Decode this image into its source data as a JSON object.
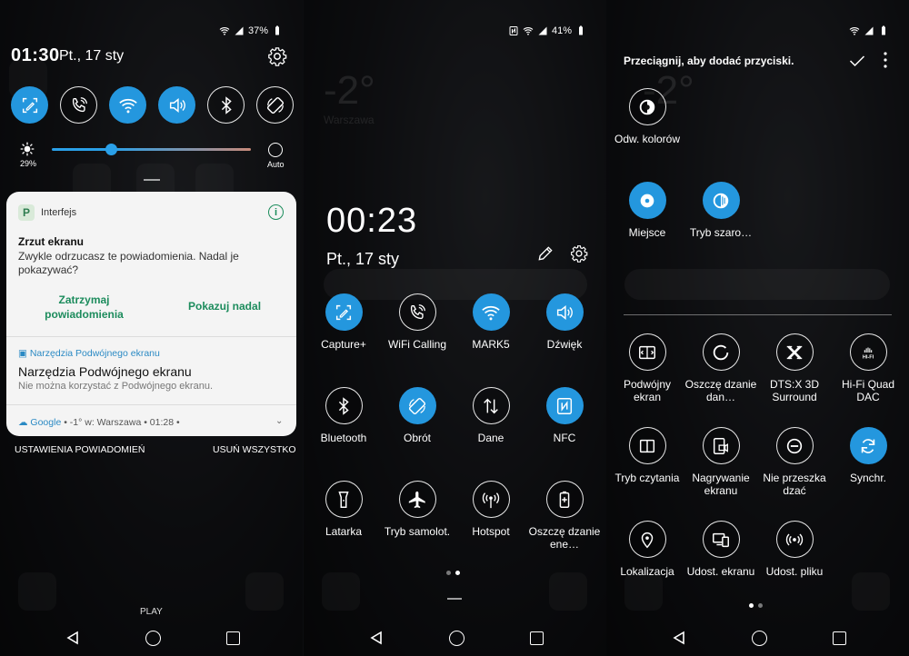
{
  "colors": {
    "accent": "#2497de",
    "notif_action": "#1d8c5d",
    "card_bg": "#f4f4f4"
  },
  "panel1": {
    "status": {
      "battery": "37%"
    },
    "clock": "01:30",
    "date": "Pt., 17 sty",
    "quick_tiles": [
      {
        "icon": "capture-plus-icon",
        "on": true
      },
      {
        "icon": "wifi-calling-icon",
        "on": false
      },
      {
        "icon": "wifi-icon",
        "on": true
      },
      {
        "icon": "sound-icon",
        "on": true
      },
      {
        "icon": "bluetooth-icon",
        "on": false
      },
      {
        "icon": "rotate-icon",
        "on": false
      }
    ],
    "brightness": {
      "percent_label": "29%",
      "level": 0.29,
      "auto_label": "Auto"
    },
    "notification": {
      "app_name": "Interfejs",
      "title": "Zrzut ekranu",
      "body": "Zwykle odrzucasz te powiadomienia. Nadal je pokazywać?",
      "action_stop": "Zatrzymaj powiadomienia",
      "action_keep": "Pokazuj nadal",
      "sub_app": "Narzędzia Podwójnego ekranu",
      "sub_title": "Narzędzia Podwójnego ekranu",
      "sub_body": "Nie można korzystać z Podwójnego ekranu.",
      "google_app": "Google",
      "google_text": "• -1° w: Warszawa • 01:28 •"
    },
    "footer_left": "USTAWIENIA POWIADOMIEŃ",
    "footer_right": "USUŃ WSZYSTKO",
    "play_label": "PLAY"
  },
  "panel2": {
    "status": {
      "battery": "41%"
    },
    "clock": "00:23",
    "date": "Pt., 17 sty",
    "tiles": [
      {
        "label": "Capture+",
        "icon": "capture-plus-icon",
        "on": true
      },
      {
        "label": "WiFi Calling",
        "icon": "wifi-calling-icon",
        "on": false
      },
      {
        "label": "MARK5",
        "icon": "wifi-icon",
        "on": true
      },
      {
        "label": "Dźwięk",
        "icon": "sound-icon",
        "on": true
      },
      {
        "label": "Bluetooth",
        "icon": "bluetooth-icon",
        "on": false
      },
      {
        "label": "Obrót",
        "icon": "rotate-icon",
        "on": true
      },
      {
        "label": "Dane",
        "icon": "data-icon",
        "on": false
      },
      {
        "label": "NFC",
        "icon": "nfc-icon",
        "on": true
      },
      {
        "label": "Latarka",
        "icon": "flashlight-icon",
        "on": false
      },
      {
        "label": "Tryb samolot.",
        "icon": "airplane-icon",
        "on": false
      },
      {
        "label": "Hotspot",
        "icon": "hotspot-icon",
        "on": false
      },
      {
        "label": "Oszczę dzanie ene…",
        "icon": "battery-saver-icon",
        "on": false
      }
    ]
  },
  "panel3": {
    "title": "Przeciągnij, aby dodać przyciski.",
    "active_tiles": [
      {
        "label": "Odw. kolorów",
        "icon": "invert-colors-icon",
        "on": false
      },
      {
        "label": "Miejsce",
        "icon": "location-dot-icon",
        "on": true
      },
      {
        "label": "Tryb szaro…",
        "icon": "grayscale-icon",
        "on": true
      }
    ],
    "available_tiles": [
      {
        "label": "Podwójny ekran",
        "icon": "dual-screen-icon",
        "on": false
      },
      {
        "label": "Oszczę dzanie dan…",
        "icon": "data-saver-icon",
        "on": false
      },
      {
        "label": "DTS:X 3D Surround",
        "icon": "dtsx-icon",
        "on": false
      },
      {
        "label": "Hi-Fi Quad DAC",
        "icon": "hifi-icon",
        "on": false
      },
      {
        "label": "Tryb czytania",
        "icon": "reading-mode-icon",
        "on": false
      },
      {
        "label": "Nagrywanie ekranu",
        "icon": "screen-record-icon",
        "on": false
      },
      {
        "label": "Nie przeszka dzać",
        "icon": "do-not-disturb-icon",
        "on": false
      },
      {
        "label": "Synchr.",
        "icon": "sync-icon",
        "on": true
      },
      {
        "label": "Lokalizacja",
        "icon": "location-pin-icon",
        "on": false
      },
      {
        "label": "Udost. ekranu",
        "icon": "screen-share-icon",
        "on": false
      },
      {
        "label": "Udost. pliku",
        "icon": "file-share-icon",
        "on": false
      }
    ]
  }
}
